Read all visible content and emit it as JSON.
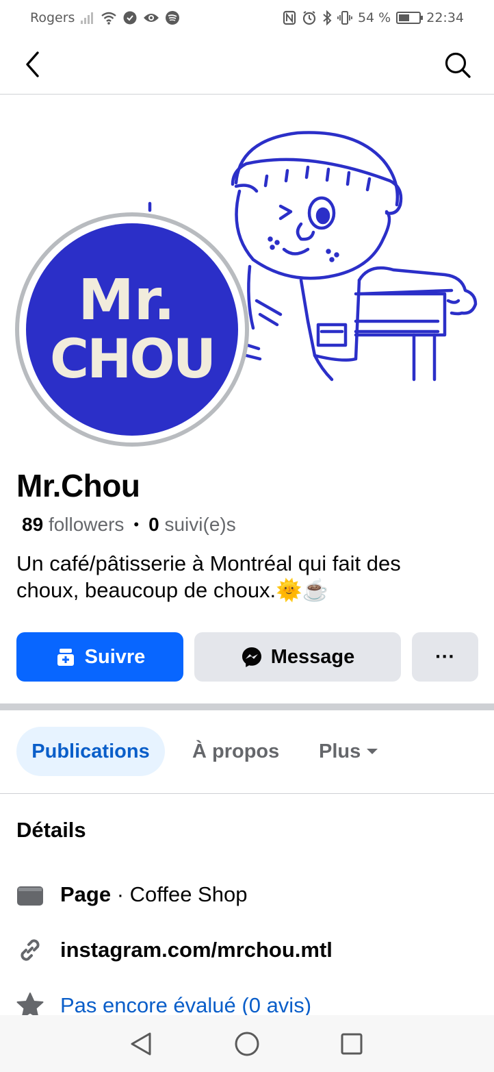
{
  "status_bar": {
    "carrier": "Rogers",
    "battery_percent_label": "54 %",
    "battery_level": 0.54,
    "time": "22:34"
  },
  "topnav": {
    "back_icon": "chevron-left-icon",
    "search_icon": "search-icon"
  },
  "profile": {
    "logo_text_line1": "Mr.",
    "logo_text_line2": "CHOU",
    "name": "Mr.Chou",
    "followers_count": "89",
    "followers_label": "followers",
    "following_count": "0",
    "following_label": "suivi(e)s",
    "bio_line1": "Un café/pâtisserie à Montréal qui fait des",
    "bio_line2": "choux, beaucoup de choux.🌞☕"
  },
  "actions": {
    "follow_label": "Suivre",
    "message_label": "Message",
    "more_label": "···"
  },
  "tabs": [
    {
      "label": "Publications",
      "active": true
    },
    {
      "label": "À propos",
      "active": false
    },
    {
      "label": "Plus",
      "active": false
    }
  ],
  "details": {
    "title": "Détails",
    "page_label": "Page",
    "page_separator": " · ",
    "page_category": "Coffee Shop",
    "website": "instagram.com/mrchou.mtl",
    "rating": "Pas encore évalué (0 avis)"
  },
  "colors": {
    "primary_blue": "#0866ff",
    "brand_blue": "#2b2fc8",
    "link_blue": "#0a5ec9",
    "gray_button": "#e4e6eb"
  }
}
